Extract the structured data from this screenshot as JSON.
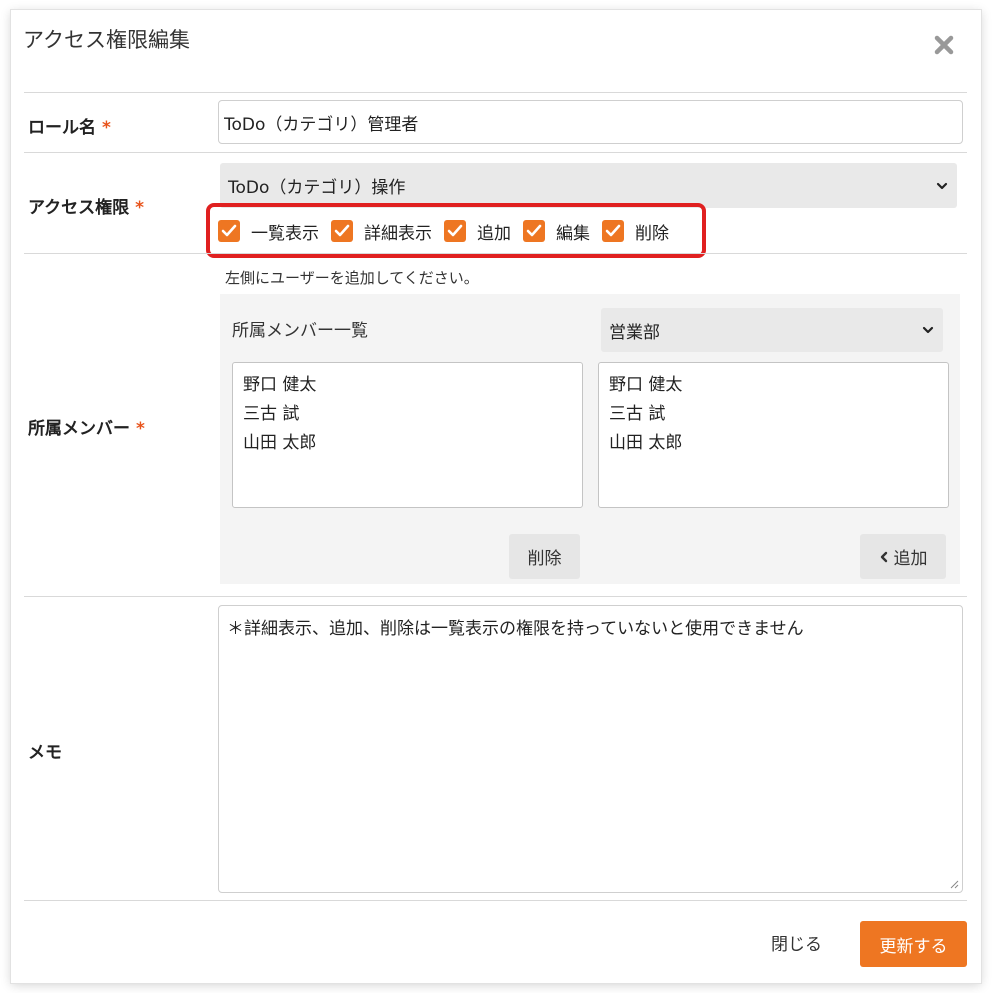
{
  "dialog": {
    "title": "アクセス権限編集"
  },
  "role": {
    "label": "ロール名",
    "required_mark": "*",
    "value": "ToDo（カテゴリ）管理者"
  },
  "access": {
    "label": "アクセス権限",
    "required_mark": "*",
    "select_value": "ToDo（カテゴリ）操作",
    "permissions": [
      {
        "label": "一覧表示",
        "checked": true
      },
      {
        "label": "詳細表示",
        "checked": true
      },
      {
        "label": "追加",
        "checked": true
      },
      {
        "label": "編集",
        "checked": true
      },
      {
        "label": "削除",
        "checked": true
      }
    ],
    "highlight_color": "#e02020"
  },
  "members": {
    "label": "所属メンバー",
    "required_mark": "*",
    "hint": "左側にユーザーを追加してください。",
    "list_title": "所属メンバー一覧",
    "department_select": "営業部",
    "assigned": [
      "野口 健太",
      "三古 試",
      "山田 太郎"
    ],
    "available": [
      "野口 健太",
      "三古 試",
      "山田 太郎"
    ],
    "remove_button": "削除",
    "add_button": "追加"
  },
  "memo": {
    "label": "メモ",
    "value": "＊詳細表示、追加、削除は一覧表示の権限を持っていないと使用できません"
  },
  "footer": {
    "close_button": "閉じる",
    "submit_button": "更新する"
  },
  "colors": {
    "accent": "#ee7622",
    "required": "#e8541c"
  }
}
